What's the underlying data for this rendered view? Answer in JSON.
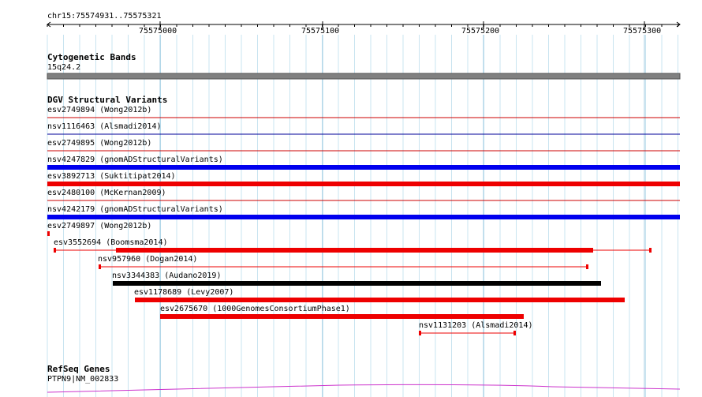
{
  "ruler": {
    "region": "chr15:75574931..75575321",
    "ticks": [
      "75575000",
      "75575100",
      "75575200",
      "75575300"
    ]
  },
  "cytoband": {
    "title": "Cytogenetic Bands",
    "band": "15q24.2"
  },
  "dgv": {
    "title": "DGV Structural Variants",
    "variants": [
      {
        "label": "esv2749894 (Wong2012b)",
        "color": "#cc0000"
      },
      {
        "label": "nsv1116463 (Alsmadi2014)",
        "color": "#000099"
      },
      {
        "label": "esv2749895 (Wong2012b)",
        "color": "#cc0000"
      },
      {
        "label": "nsv4247829 (gnomADStructuralVariants)",
        "color": "#0000ee"
      },
      {
        "label": "esv3892713 (Suktitipat2014)",
        "color": "#ee0000"
      },
      {
        "label": "esv2480100 (McKernan2009)",
        "color": "#cc0000"
      },
      {
        "label": "nsv4242179 (gnomADStructuralVariants)",
        "color": "#0000ee"
      },
      {
        "label": "esv2749897 (Wong2012b)",
        "color": "#ee0000"
      },
      {
        "label": "esv3552694 (Boomsma2014)",
        "color": "#ee0000"
      },
      {
        "label": "nsv957960 (Dogan2014)",
        "color": "#ee0000"
      },
      {
        "label": "nsv3344383 (Audano2019)",
        "color": "#000000"
      },
      {
        "label": "esv1178689 (Levy2007)",
        "color": "#ee0000"
      },
      {
        "label": "esv2675670 (1000GenomesConsortiumPhase1)",
        "color": "#ee0000"
      },
      {
        "label": "nsv1131203 (Alsmadi2014)",
        "color": "#ee0000"
      }
    ]
  },
  "refseq": {
    "title": "RefSeq Genes",
    "gene": "PTPN9|NM_002833",
    "color": "#cc33cc"
  }
}
